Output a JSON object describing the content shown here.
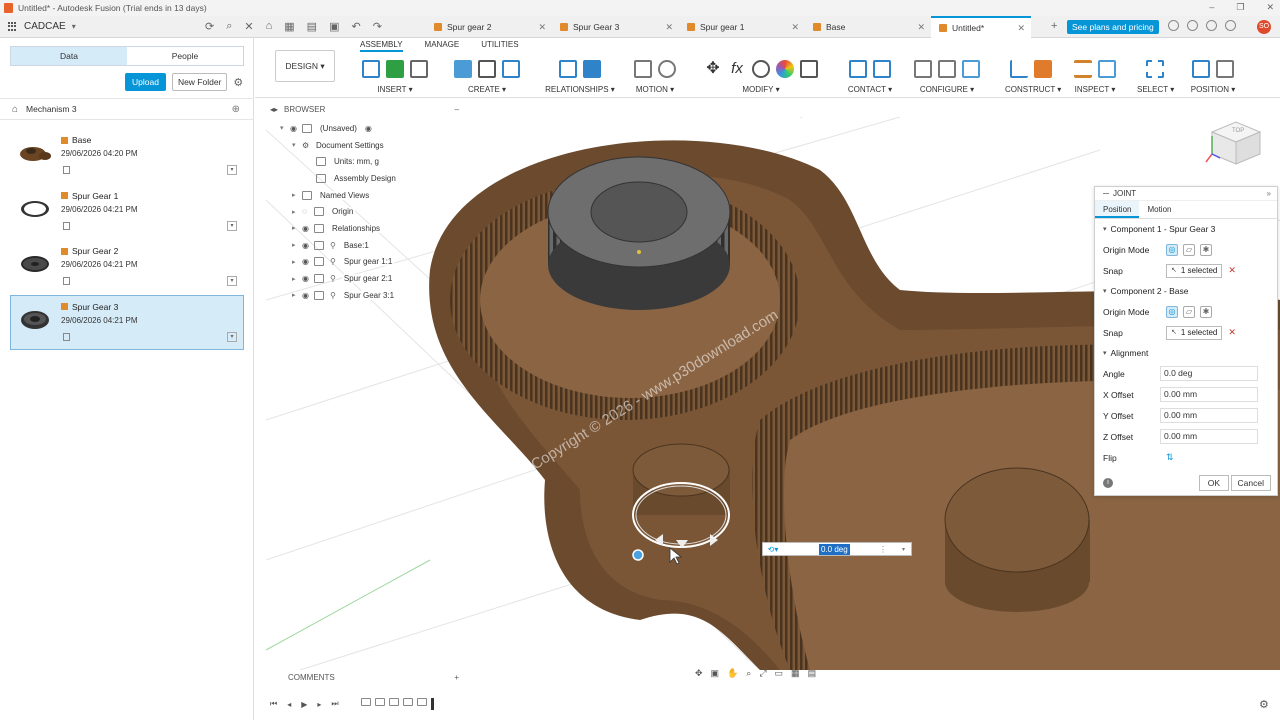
{
  "window": {
    "title": "Untitled* - Autodesk Fusion (Trial ends in 13 days)"
  },
  "brand": {
    "name": "CADCAE"
  },
  "doc_tabs": [
    {
      "label": "Spur gear 2",
      "active": false
    },
    {
      "label": "Spur Gear 3",
      "active": false
    },
    {
      "label": "Spur gear 1",
      "active": false
    },
    {
      "label": "Base",
      "active": false
    },
    {
      "label": "Untitled*",
      "active": true
    }
  ],
  "plans_label": "See plans and pricing",
  "avatar_initials": "SO",
  "data_panel": {
    "tabs": [
      "Data",
      "People"
    ],
    "upload_label": "Upload",
    "new_folder_label": "New Folder",
    "path": "Mechanism 3",
    "files": [
      {
        "name": "Base",
        "date": "29/06/2026 04:20 PM",
        "selected": false
      },
      {
        "name": "Spur Gear 1",
        "date": "29/06/2026 04:21 PM",
        "selected": false
      },
      {
        "name": "Spur Gear 2",
        "date": "29/06/2026 04:21 PM",
        "selected": false
      },
      {
        "name": "Spur Gear 3",
        "date": "29/06/2026 04:21 PM",
        "selected": true
      }
    ]
  },
  "toolbar": {
    "design_label": "DESIGN",
    "workspace_tabs": [
      "ASSEMBLY",
      "MANAGE",
      "UTILITIES"
    ],
    "groups": [
      "INSERT",
      "CREATE",
      "RELATIONSHIPS",
      "MOTION",
      "MODIFY",
      "CONTACT",
      "CONFIGURE",
      "CONSTRUCT",
      "INSPECT",
      "SELECT",
      "POSITION"
    ]
  },
  "browser": {
    "header": "BROWSER",
    "items": [
      {
        "label": "(Unsaved)",
        "indent": 0
      },
      {
        "label": "Document Settings",
        "indent": 1
      },
      {
        "label": "Units: mm, g",
        "indent": 2
      },
      {
        "label": "Assembly Design",
        "indent": 2
      },
      {
        "label": "Named Views",
        "indent": 1
      },
      {
        "label": "Origin",
        "indent": 1
      },
      {
        "label": "Relationships",
        "indent": 1
      },
      {
        "label": "Base:1",
        "indent": 1
      },
      {
        "label": "Spur gear 1:1",
        "indent": 1
      },
      {
        "label": "Spur gear 2:1",
        "indent": 1
      },
      {
        "label": "Spur Gear 3:1",
        "indent": 1
      }
    ]
  },
  "viewport": {
    "watermark": "Copyright © 2026 - www.p30download.com",
    "viewcube_label": "TOP"
  },
  "joint_panel": {
    "title": "JOINT",
    "tabs": [
      "Position",
      "Motion"
    ],
    "component1": {
      "title": "Component 1 - Spur Gear 3",
      "origin_mode_label": "Origin Mode",
      "snap_label": "Snap",
      "snap_value": "1 selected"
    },
    "component2": {
      "title": "Component 2 - Base",
      "origin_mode_label": "Origin Mode",
      "snap_label": "Snap",
      "snap_value": "1 selected"
    },
    "alignment": {
      "title": "Alignment",
      "angle": {
        "label": "Angle",
        "value": "0.0 deg"
      },
      "x_offset": {
        "label": "X Offset",
        "value": "0.00 mm"
      },
      "y_offset": {
        "label": "Y Offset",
        "value": "0.00 mm"
      },
      "z_offset": {
        "label": "Z Offset",
        "value": "0.00 mm"
      },
      "flip_label": "Flip"
    },
    "ok_label": "OK",
    "cancel_label": "Cancel"
  },
  "angle_input": {
    "value": "0.0 deg"
  },
  "comments": {
    "label": "COMMENTS"
  }
}
